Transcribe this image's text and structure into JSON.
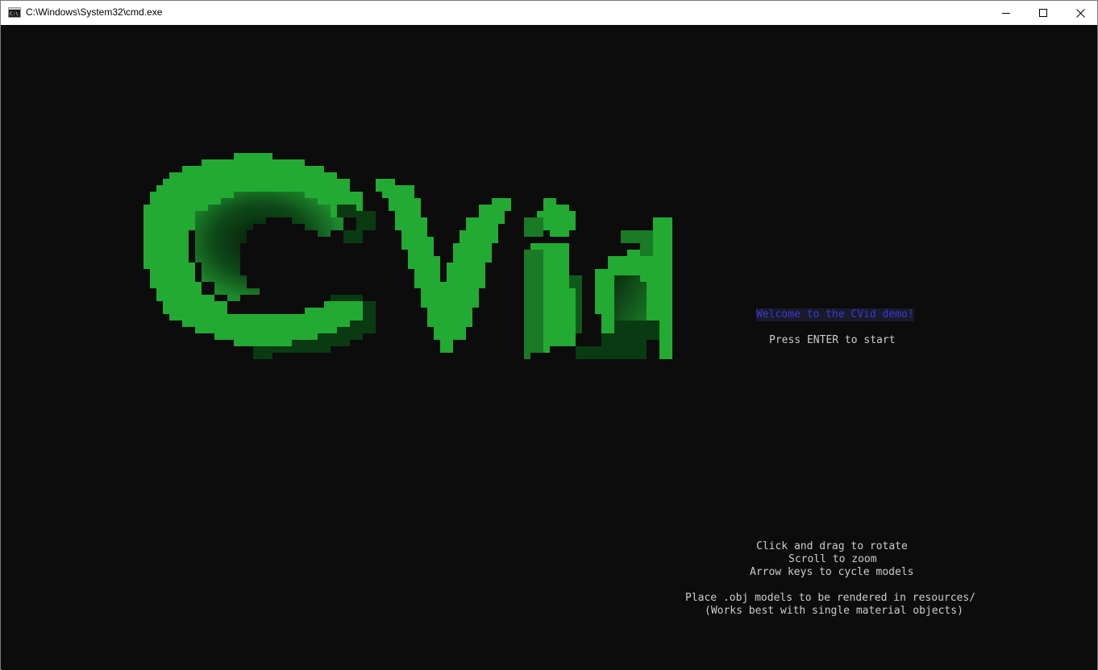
{
  "window": {
    "title": "C:\\Windows\\System32\\cmd.exe",
    "icon": "cmd-icon",
    "controls": {
      "minimize": "minimize-icon",
      "maximize": "maximize-icon",
      "close": "close-icon"
    }
  },
  "console": {
    "logo_text": "CVid",
    "welcome": "Welcome to the CVid demo!",
    "press_enter": "Press ENTER to start",
    "hints": [
      "Click and drag to rotate",
      "Scroll to zoom",
      "Arrow keys to cycle models",
      "Place .obj models to be rendered in resources/",
      "(Works best with single material objects)"
    ]
  },
  "colors": {
    "background": "#0c0c0c",
    "logo_green": "#22aa33",
    "logo_shadow": "#0a3a12",
    "welcome_text": "#3a3ad8",
    "console_text": "#cccccc"
  }
}
